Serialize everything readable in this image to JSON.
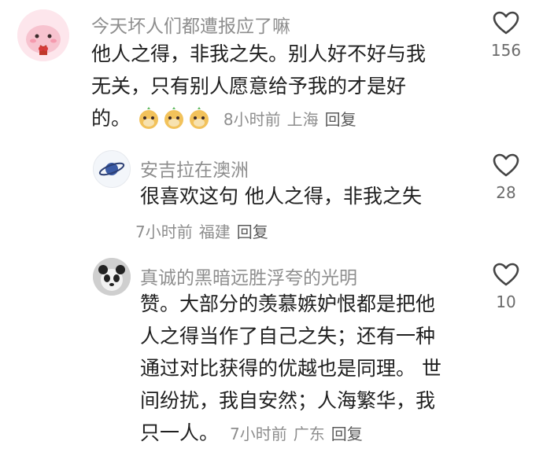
{
  "comments": [
    {
      "username": "今天坏人们都遭报应了嘛",
      "lines": [
        "他人之得，非我之失。别人好不好与我",
        "无关，只有别人愿意给予我的才是好",
        "的。"
      ],
      "emoji_icon": "meerkat-emoji-icon",
      "time": "8小时前",
      "location": "上海",
      "reply": "回复",
      "likes": "156"
    },
    {
      "username": "安吉拉在澳洲",
      "lines": [
        "很喜欢这句 他人之得，非我之失"
      ],
      "time": "7小时前",
      "location": "福建",
      "reply": "回复",
      "likes": "28"
    },
    {
      "username": "真诚的黑暗远胜浮夸的光明",
      "lines": [
        "赞。大部分的羡慕嫉妒恨都是把他",
        "人之得当作了自己之失；还有一种",
        "通过对比获得的优越也是同理。 世",
        "间纷扰，我自安然；人海繁华，我",
        "只一人。"
      ],
      "time": "7小时前",
      "location": "广东",
      "reply": "回复",
      "likes": "10"
    }
  ],
  "colors": {
    "name": "#8e8e8e",
    "text": "#202020",
    "meta": "#8e8e8e"
  }
}
